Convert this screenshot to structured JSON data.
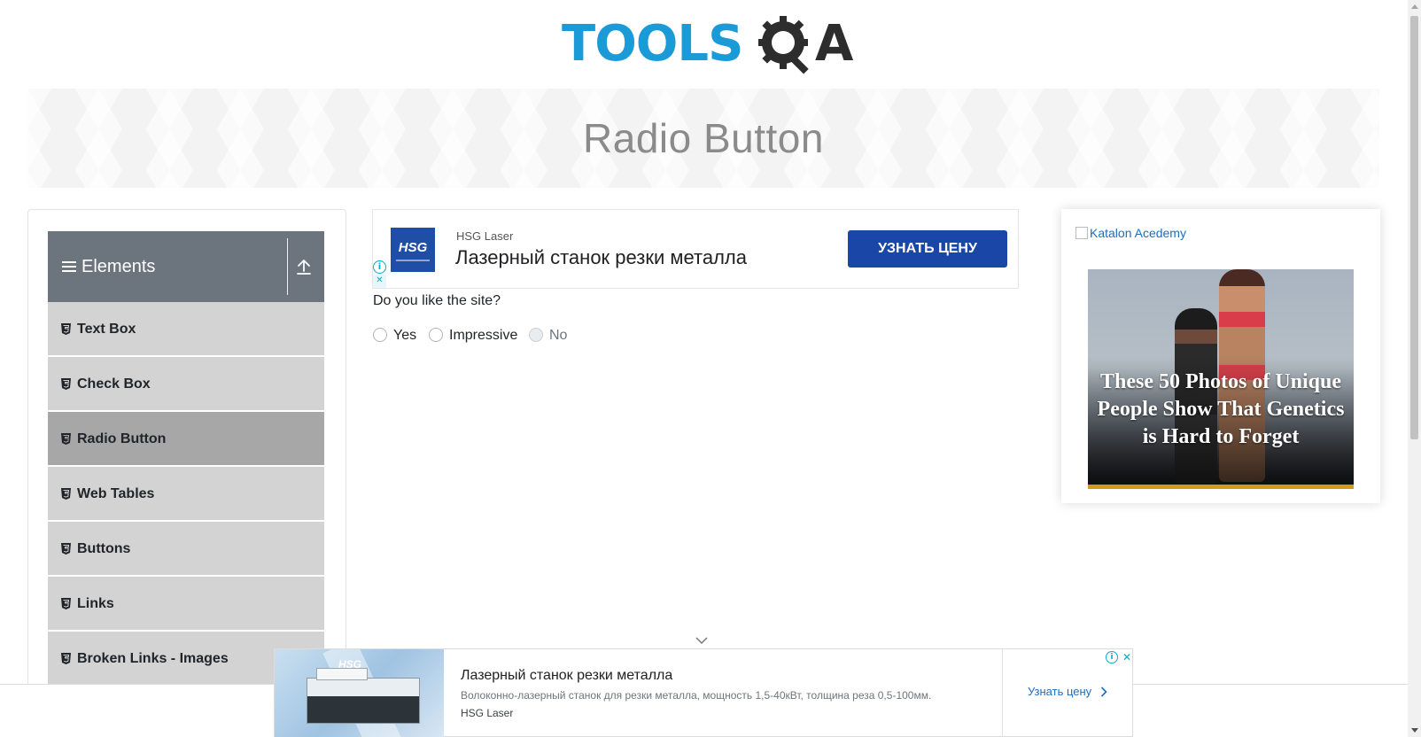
{
  "header": {
    "logo_primary": "TOOLS",
    "logo_secondary": "A",
    "logo_icon": "gear-magnifier-icon"
  },
  "banner": {
    "title": "Radio Button"
  },
  "sidebar": {
    "group_title": "Elements",
    "group_icon": "menu-icon",
    "collapse_icon": "arrow-up-icon",
    "items": [
      {
        "label": "Text Box",
        "active": false
      },
      {
        "label": "Check Box",
        "active": false
      },
      {
        "label": "Radio Button",
        "active": true
      },
      {
        "label": "Web Tables",
        "active": false
      },
      {
        "label": "Buttons",
        "active": false
      },
      {
        "label": "Links",
        "active": false
      },
      {
        "label": "Broken Links - Images",
        "active": false
      }
    ]
  },
  "top_ad": {
    "logo_text": "HSG",
    "brand": "HSG Laser",
    "headline": "Лазерный станок резки металла",
    "cta": "УЗНАТЬ ЦЕНУ",
    "info_glyph": "i",
    "close_glyph": "✕"
  },
  "main": {
    "question": "Do you like the site?",
    "options": [
      {
        "label": "Yes",
        "disabled": false
      },
      {
        "label": "Impressive",
        "disabled": false
      },
      {
        "label": "No",
        "disabled": true
      }
    ]
  },
  "right_ad": {
    "broken_image_alt": "Katalon Acedemy",
    "promo_text": "These 50 Photos of Unique People Show That Genetics is Hard to Forget"
  },
  "bottom_ad": {
    "logo_text": "HSG",
    "headline": "Лазерный станок резки металла",
    "description": "Волоконно-лазерный станок для резки металла, мощность 1,5-40кВт, толщина реза 0,5-100мм.",
    "brand": "HSG Laser",
    "cta": "Узнать цену",
    "info_glyph": "i",
    "close_glyph": "✕"
  },
  "colors": {
    "logo_blue": "#1a9ad6",
    "logo_dark": "#2d2d2d",
    "nav_header": "#6c757d",
    "nav_item": "#d3d3d3",
    "nav_active": "#a7a7a7",
    "ad_cta": "#1a46a8"
  }
}
